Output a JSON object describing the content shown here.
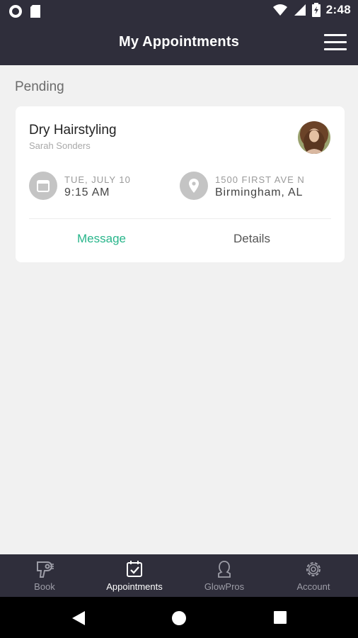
{
  "status_bar": {
    "time": "2:48",
    "icons": [
      "circle-notification-icon",
      "sd-card-icon",
      "wifi-icon",
      "cell-signal-icon",
      "battery-icon"
    ]
  },
  "header": {
    "title": "My Appointments",
    "menu_icon": "hamburger-menu-icon"
  },
  "section": {
    "label": "Pending"
  },
  "appointment": {
    "service": "Dry Hairstyling",
    "stylist": "Sarah Sonders",
    "date": "TUE, JULY 10",
    "time": "9:15 AM",
    "address_line1": "1500 FIRST AVE N",
    "address_line2": "Birmingham, AL",
    "actions": {
      "message": "Message",
      "details": "Details"
    }
  },
  "bottom_nav": {
    "items": [
      {
        "label": "Book",
        "icon": "hair-dryer-icon",
        "active": false
      },
      {
        "label": "Appointments",
        "icon": "calendar-check-icon",
        "active": true
      },
      {
        "label": "GlowPros",
        "icon": "person-silhouette-icon",
        "active": false
      },
      {
        "label": "Account",
        "icon": "gear-icon",
        "active": false
      }
    ]
  },
  "colors": {
    "header_bg": "#2f2e3b",
    "page_bg": "#f1f1f1",
    "accent_green": "#27b58a",
    "nav_inactive": "#9d9da7"
  }
}
